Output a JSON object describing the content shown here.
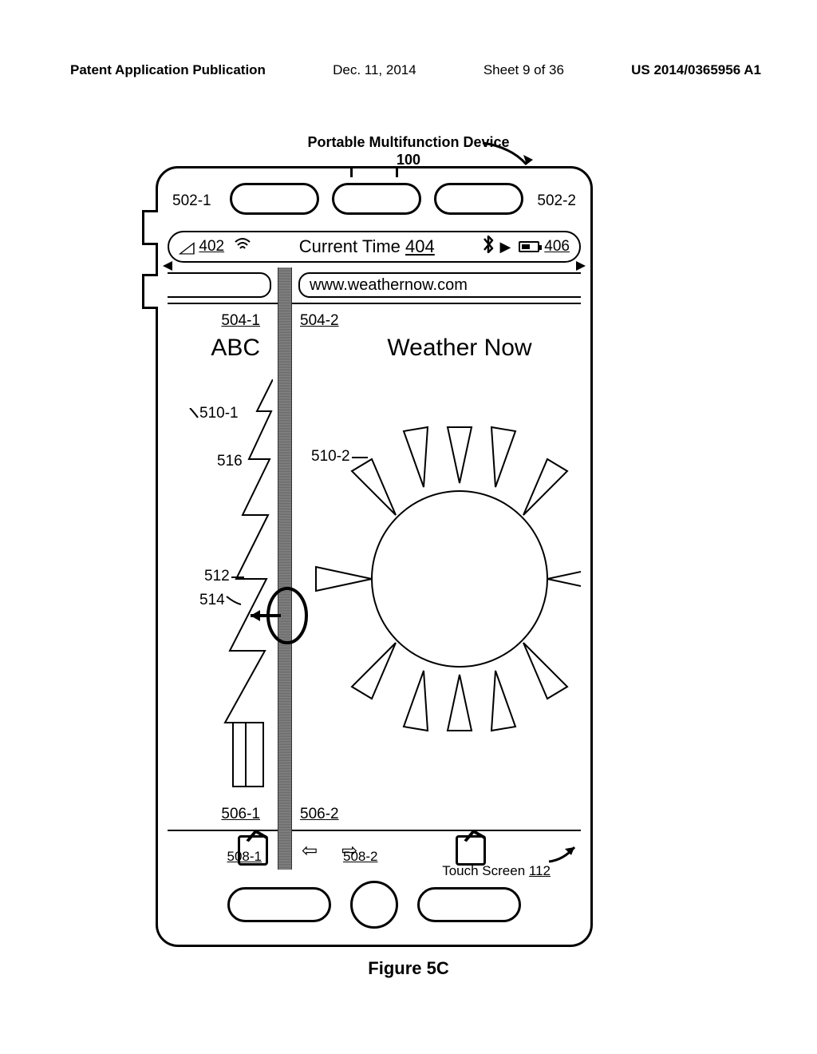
{
  "header": {
    "publication_label": "Patent Application Publication",
    "date": "Dec. 11, 2014",
    "sheet": "Sheet 9 of 36",
    "pub_number": "US 2014/0365956 A1"
  },
  "figure": {
    "caption": "Figure 5C",
    "device_title": "Portable Multifunction Device",
    "device_ref": "100",
    "touch_screen_label": "Touch Screen",
    "touch_screen_ref": "112"
  },
  "refs": {
    "top_left": "502-1",
    "top_right": "502-2",
    "signal": "402",
    "time": "404",
    "battery": "406",
    "url_left": "504-1",
    "url_right": "504-2",
    "content_left": "506-1",
    "content_right": "506-2",
    "toolbar_left": "508-1",
    "toolbar_right": "508-2",
    "app_left_id": "510-1",
    "app_right_id": "510-2",
    "gesture_contact": "512",
    "gesture_direction": "514",
    "divider_ref": "516"
  },
  "status_bar": {
    "time_label": "Current Time"
  },
  "left_app": {
    "title": "ABC",
    "url": ""
  },
  "right_app": {
    "title": "Weather Now",
    "url": "www.weathernow.com"
  }
}
